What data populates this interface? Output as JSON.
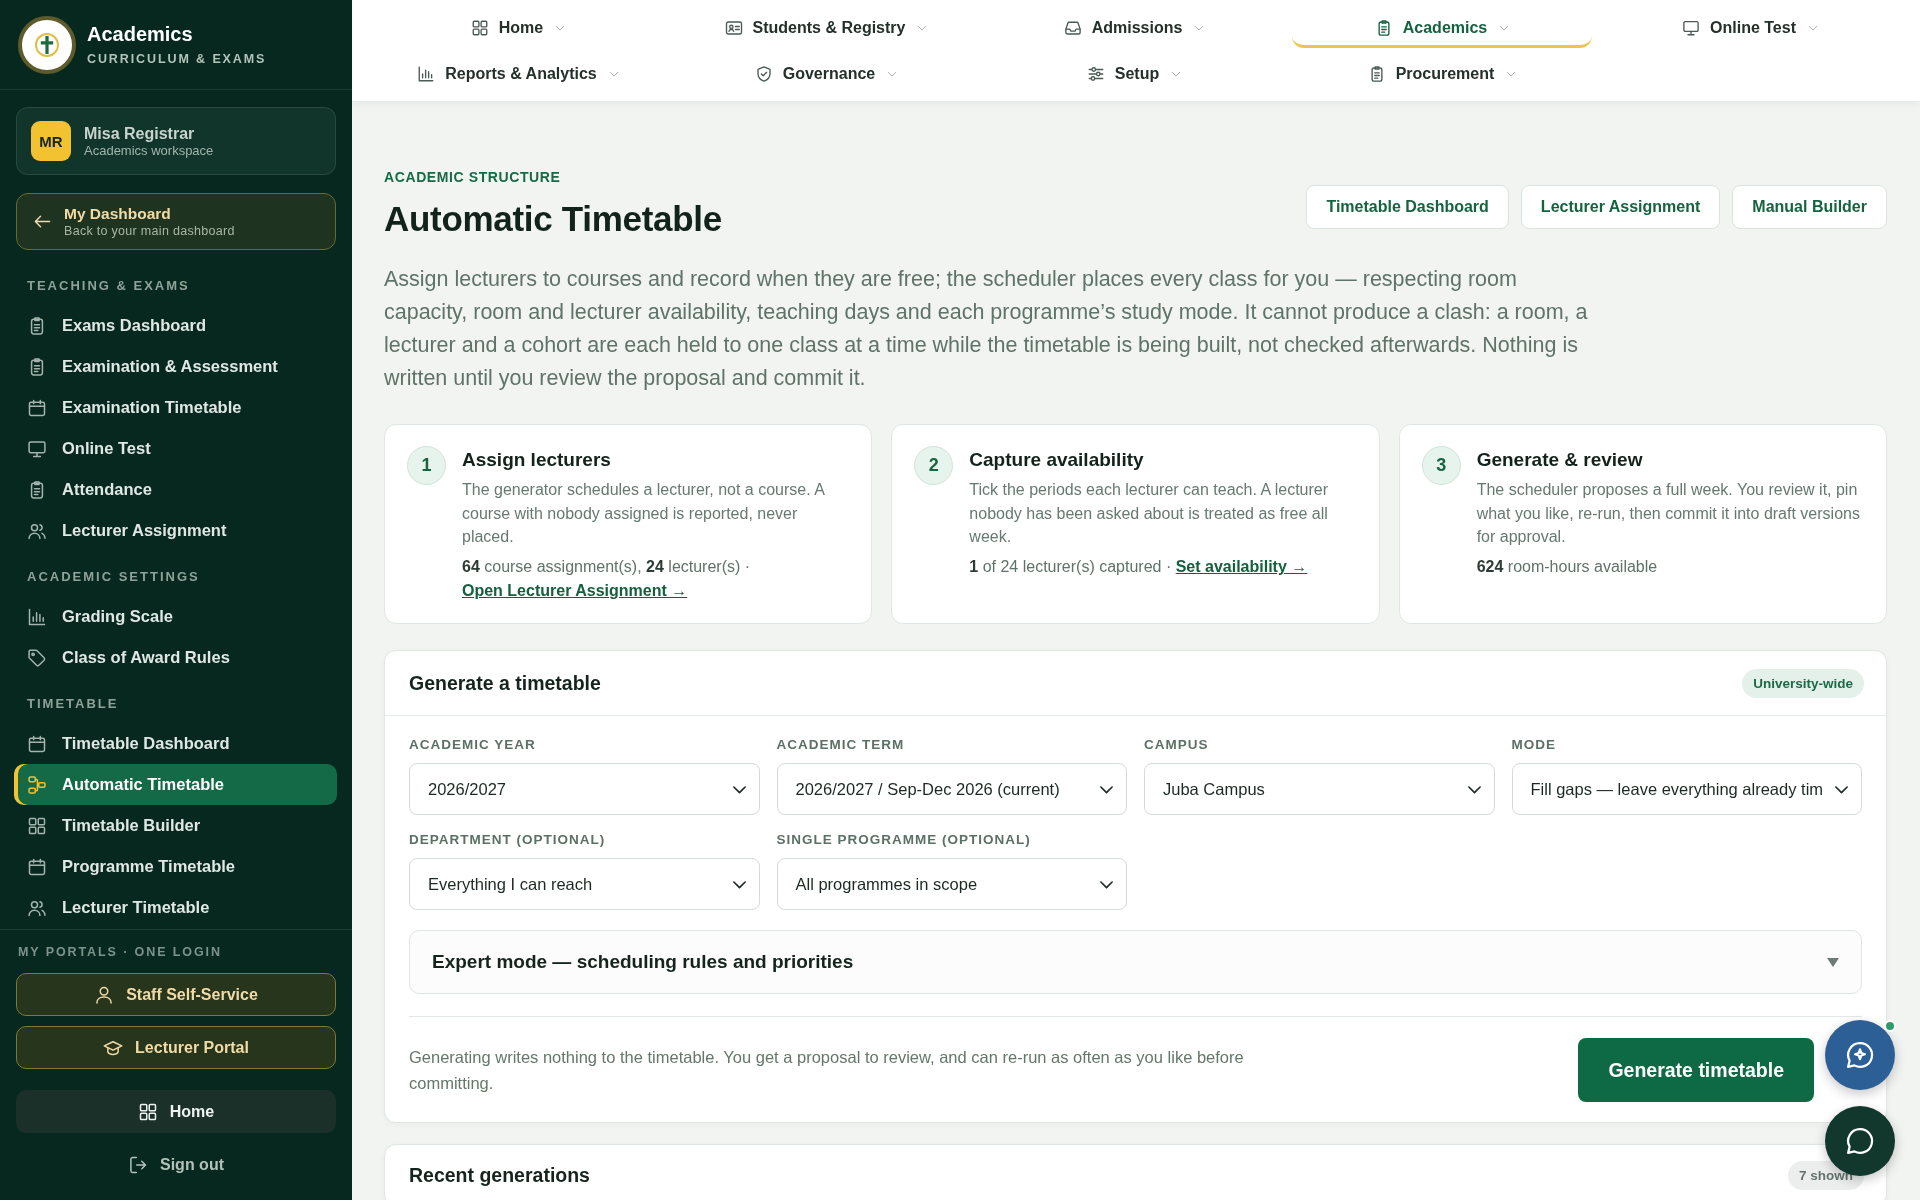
{
  "sidebar": {
    "brand": {
      "title": "Academics",
      "subtitle": "CURRICULUM & EXAMS"
    },
    "user": {
      "initials": "MR",
      "name": "Misa Registrar",
      "role": "Academics workspace"
    },
    "back_link": {
      "title": "My Dashboard",
      "subtitle": "Back to your main dashboard"
    },
    "sections": [
      {
        "heading": "TEACHING & EXAMS",
        "items": [
          {
            "label": "Exams Dashboard",
            "selected": false
          },
          {
            "label": "Examination & Assessment",
            "selected": false
          },
          {
            "label": "Examination Timetable",
            "selected": false
          },
          {
            "label": "Online Test",
            "selected": false
          },
          {
            "label": "Attendance",
            "selected": false
          },
          {
            "label": "Lecturer Assignment",
            "selected": false
          }
        ]
      },
      {
        "heading": "ACADEMIC SETTINGS",
        "items": [
          {
            "label": "Grading Scale",
            "selected": false
          },
          {
            "label": "Class of Award Rules",
            "selected": false
          }
        ]
      },
      {
        "heading": "TIMETABLE",
        "items": [
          {
            "label": "Timetable Dashboard",
            "selected": false
          },
          {
            "label": "Automatic Timetable",
            "selected": true
          },
          {
            "label": "Timetable Builder",
            "selected": false
          },
          {
            "label": "Programme Timetable",
            "selected": false
          },
          {
            "label": "Lecturer Timetable",
            "selected": false
          }
        ]
      }
    ],
    "portals": {
      "heading": "MY PORTALS · ONE LOGIN",
      "links": [
        "Staff Self-Service",
        "Lecturer Portal"
      ]
    },
    "home_button": "Home",
    "sign_out": "Sign out"
  },
  "top_nav": [
    {
      "label": "Home",
      "selected": false
    },
    {
      "label": "Students & Registry",
      "selected": false
    },
    {
      "label": "Admissions",
      "selected": false
    },
    {
      "label": "Academics",
      "selected": true
    },
    {
      "label": "Online Test",
      "selected": false
    },
    {
      "label": "Reports & Analytics",
      "selected": false
    },
    {
      "label": "Governance",
      "selected": false
    },
    {
      "label": "Setup",
      "selected": false
    },
    {
      "label": "Procurement",
      "selected": false
    }
  ],
  "page": {
    "eyebrow": "ACADEMIC STRUCTURE",
    "title": "Automatic Timetable",
    "actions": [
      "Timetable Dashboard",
      "Lecturer Assignment",
      "Manual Builder"
    ],
    "intro": "Assign lecturers to courses and record when they are free; the scheduler places every class for you — respecting room capacity, room and lecturer availability, teaching days and each programme’s study mode. It cannot produce a clash: a room, a lecturer and a cohort are each held to one class at a time while the timetable is being built, not checked afterwards. Nothing is written until you review the proposal and commit it."
  },
  "steps": [
    {
      "number": "1",
      "title": "Assign lecturers",
      "body": "The generator schedules a lecturer, not a course. A course with nobody assigned is reported, never placed.",
      "stats": "**64** course assignment(s), **24** lecturer(s) ·",
      "link": "Open Lecturer Assignment →"
    },
    {
      "number": "2",
      "title": "Capture availability",
      "body": "Tick the periods each lecturer can teach. A lecturer nobody has been asked about is treated as free all week.",
      "stats": "**1** of 24 lecturer(s) captured ·",
      "link": "Set availability →"
    },
    {
      "number": "3",
      "title": "Generate & review",
      "body": "The scheduler proposes a full week. You review it, pin what you like, re-run, then commit it into draft versions for approval.",
      "stats": "**624** room-hours available"
    }
  ],
  "generate_panel": {
    "title": "Generate a timetable",
    "badge": "University-wide",
    "fields": [
      {
        "label": "ACADEMIC YEAR",
        "value": "2026/2027"
      },
      {
        "label": "ACADEMIC TERM",
        "value": "2026/2027 / Sep-Dec 2026 (current)"
      },
      {
        "label": "CAMPUS",
        "value": "Juba Campus"
      },
      {
        "label": "MODE",
        "value": "Fill gaps — leave everything already tim"
      },
      {
        "label": "DEPARTMENT (OPTIONAL)",
        "value": "Everything I can reach"
      },
      {
        "label": "SINGLE PROGRAMME (OPTIONAL)",
        "value": "All programmes in scope"
      }
    ],
    "expert": {
      "label": "Expert mode — scheduling rules and priorities",
      "expanded": false
    },
    "note": "Generating writes nothing to the timetable. You get a proposal to review, and can re-run as often as you like before committing.",
    "button": "Generate timetable"
  },
  "recent_panel": {
    "title": "Recent generations",
    "badge": "7 shown"
  }
}
